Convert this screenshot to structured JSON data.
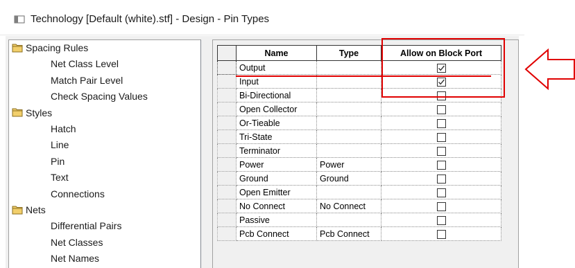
{
  "window": {
    "title": "Technology [Default (white).stf]  - Design - Pin Types"
  },
  "tree": {
    "groups": [
      {
        "label": "Spacing Rules",
        "icon": "folder-icon",
        "children": [
          "Net Class Level",
          "Match Pair Level",
          "Check Spacing Values"
        ]
      },
      {
        "label": "Styles",
        "icon": "folder-icon",
        "children": [
          "Hatch",
          "Line",
          "Pin",
          "Text",
          "Connections"
        ]
      },
      {
        "label": "Nets",
        "icon": "folder-icon",
        "children": [
          "Differential Pairs",
          "Net Classes",
          "Net Names"
        ]
      }
    ]
  },
  "grid": {
    "headers": {
      "name": "Name",
      "type": "Type",
      "allow": "Allow on Block Port"
    },
    "rows": [
      {
        "name": "Output",
        "type": "",
        "allow": true
      },
      {
        "name": "Input",
        "type": "",
        "allow": true
      },
      {
        "name": "Bi-Directional",
        "type": "",
        "allow": false
      },
      {
        "name": "Open Collector",
        "type": "",
        "allow": false
      },
      {
        "name": "Or-Tieable",
        "type": "",
        "allow": false
      },
      {
        "name": "Tri-State",
        "type": "",
        "allow": false
      },
      {
        "name": "Terminator",
        "type": "",
        "allow": false
      },
      {
        "name": "Power",
        "type": "Power",
        "allow": false
      },
      {
        "name": "Ground",
        "type": "Ground",
        "allow": false
      },
      {
        "name": "Open Emitter",
        "type": "",
        "allow": false
      },
      {
        "name": "No Connect",
        "type": "No Connect",
        "allow": false
      },
      {
        "name": "Passive",
        "type": "",
        "allow": false
      },
      {
        "name": "Pcb Connect",
        "type": "Pcb Connect",
        "allow": false
      }
    ]
  },
  "annotation": {
    "color": "#e00000"
  }
}
